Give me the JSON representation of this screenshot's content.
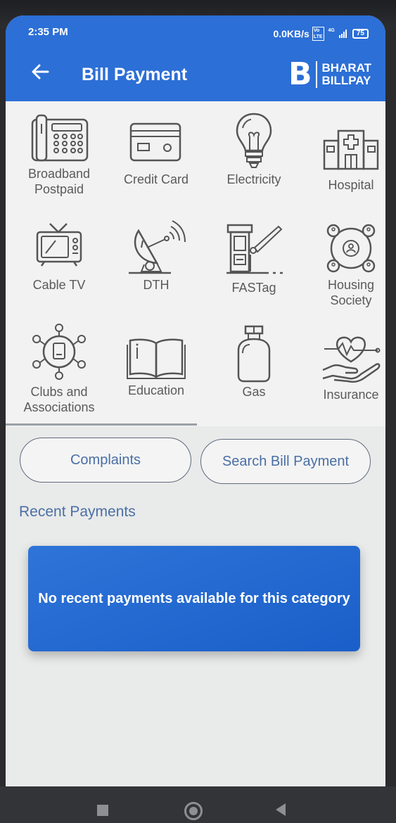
{
  "status_bar": {
    "time": "2:35 PM",
    "speed": "0.0KB/s",
    "network": "4G",
    "battery": "75"
  },
  "header": {
    "title": "Bill Payment",
    "logo_letter": "B",
    "logo_line1": "BHARAT",
    "logo_line2": "BILLPAY"
  },
  "categories": [
    {
      "line1": "Broadband",
      "line2": "Postpaid",
      "icon": "telephone-icon"
    },
    {
      "line1": "Credit Card",
      "line2": "",
      "icon": "credit-card-icon"
    },
    {
      "line1": "Electricity",
      "line2": "",
      "icon": "lightbulb-icon"
    },
    {
      "line1": "Hospital",
      "line2": "",
      "icon": "hospital-icon"
    },
    {
      "line1": "Cable TV",
      "line2": "",
      "icon": "tv-icon"
    },
    {
      "line1": "DTH",
      "line2": "",
      "icon": "satellite-dish-icon"
    },
    {
      "line1": "FASTag",
      "line2": "",
      "icon": "toll-gate-icon"
    },
    {
      "line1": "Housing",
      "line2": "Society",
      "icon": "housing-society-icon"
    },
    {
      "line1": "Clubs and",
      "line2": "Associations",
      "icon": "clubs-network-icon"
    },
    {
      "line1": "Education",
      "line2": "",
      "icon": "open-book-icon"
    },
    {
      "line1": "Gas",
      "line2": "",
      "icon": "gas-cylinder-icon"
    },
    {
      "line1": "Insurance",
      "line2": "",
      "icon": "insurance-hand-heart-icon"
    }
  ],
  "actions": {
    "complaints": "Complaints",
    "search": "Search Bill Payment"
  },
  "recent": {
    "heading": "Recent Payments",
    "empty_message": "No recent payments available for this category"
  },
  "colors": {
    "primary": "#2c6fd6",
    "link": "#4a6fa5"
  }
}
